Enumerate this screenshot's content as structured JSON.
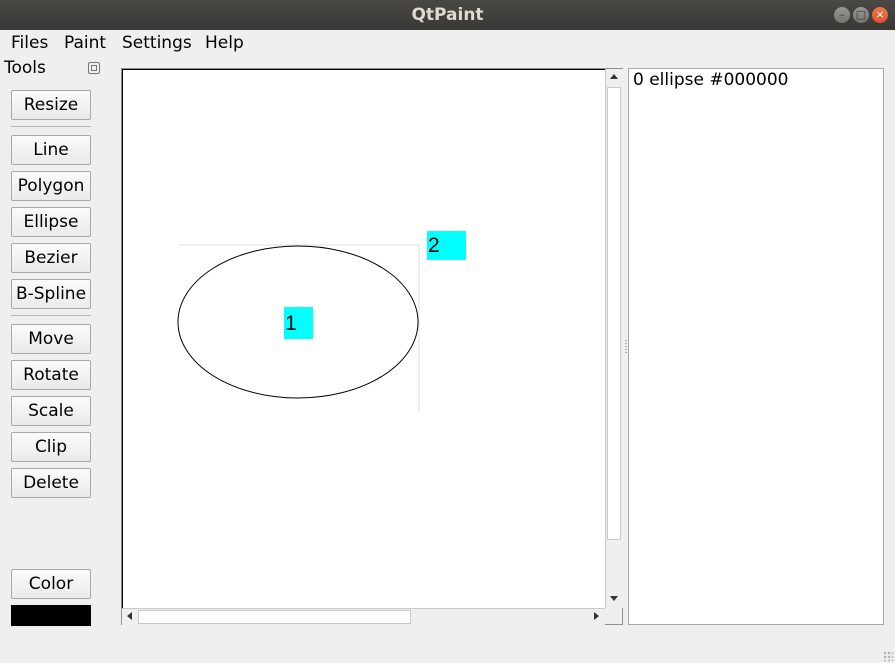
{
  "window": {
    "title": "QtPaint",
    "controls": {
      "minimize": "–",
      "maximize": "□",
      "close": "×"
    }
  },
  "menubar": [
    "Files",
    "Paint",
    "Settings",
    "Help"
  ],
  "tools_panel": {
    "title": "Tools",
    "group_1": [
      "Resize"
    ],
    "group_2": [
      "Line",
      "Polygon",
      "Ellipse",
      "Bezier",
      "B-Spline"
    ],
    "group_3": [
      "Move",
      "Rotate",
      "Scale",
      "Clip",
      "Delete"
    ],
    "color_button": "Color",
    "current_color": "#000000"
  },
  "canvas": {
    "markers": [
      {
        "label": "1",
        "color": "#00ffff"
      },
      {
        "label": "2",
        "color": "#00ffff"
      }
    ],
    "shape_stroke": "#000000"
  },
  "shape_list": {
    "items": [
      "0 ellipse #000000"
    ]
  }
}
